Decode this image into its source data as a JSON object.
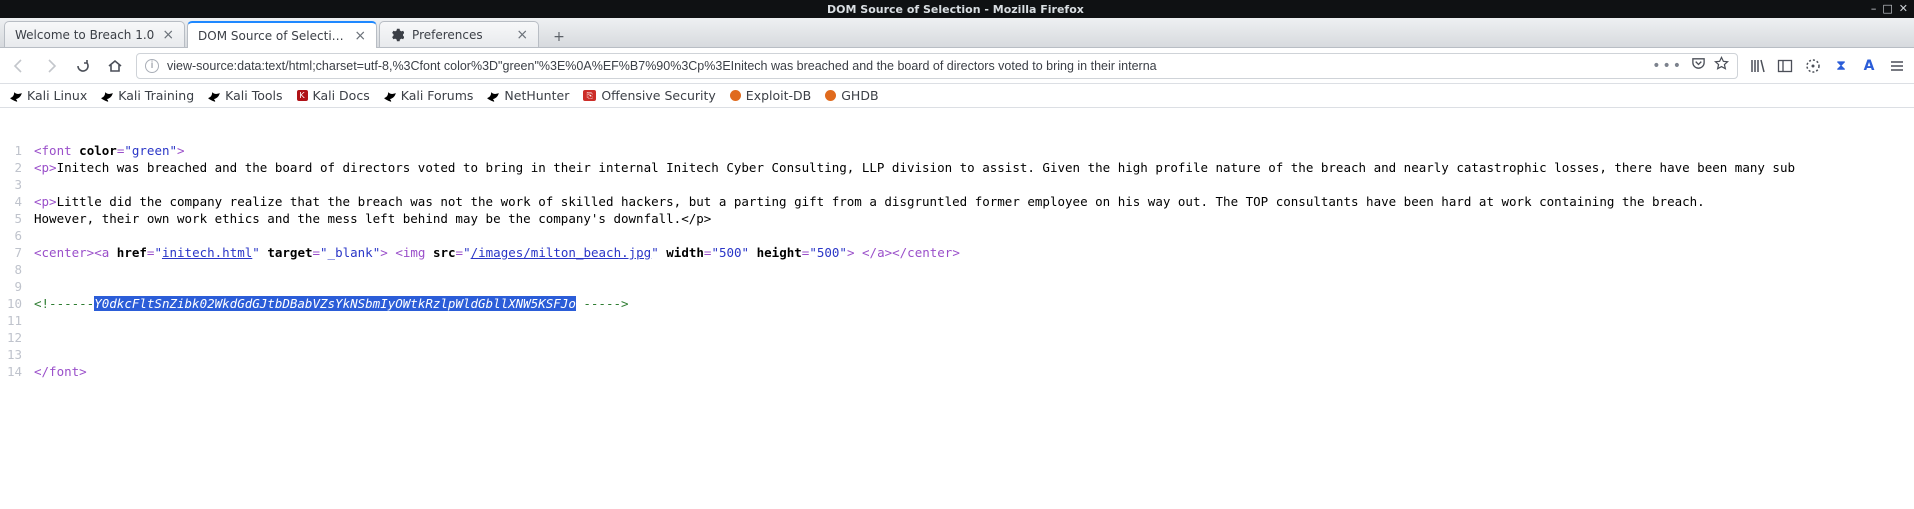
{
  "window": {
    "title": "DOM Source of Selection - Mozilla Firefox"
  },
  "tabs": [
    {
      "label": "Welcome to Breach 1.0",
      "kind": "page"
    },
    {
      "label": "DOM Source of Selection",
      "kind": "page",
      "active": true
    },
    {
      "label": "Preferences",
      "kind": "pref"
    }
  ],
  "nav": {
    "url": "view-source:data:text/html;charset=utf-8,%3Cfont color%3D\"green\"%3E%0A%EF%B7%90%3Cp%3EInitech was breached and the board of directors voted to bring in their interna"
  },
  "bookmarks": [
    {
      "label": "Kali Linux",
      "icon": "dragon"
    },
    {
      "label": "Kali Training",
      "icon": "dragon"
    },
    {
      "label": "Kali Tools",
      "icon": "dragon"
    },
    {
      "label": "Kali Docs",
      "icon": "red"
    },
    {
      "label": "Kali Forums",
      "icon": "dragon"
    },
    {
      "label": "NetHunter",
      "icon": "dragon"
    },
    {
      "label": "Offensive Security",
      "icon": "redbox"
    },
    {
      "label": "Exploit-DB",
      "icon": "orange"
    },
    {
      "label": "GHDB",
      "icon": "orange"
    }
  ],
  "source": {
    "lines": [
      {
        "n": 1,
        "type": "raw",
        "html": "<span class='c-tag'>&lt;</span><span class='c-tag'>font </span><span class='c-attname'>color</span><span class='c-tag'>=</span><span class='c-attval'>\"green\"</span><span class='c-tag'>&gt;</span>"
      },
      {
        "n": 2,
        "type": "raw",
        "html": "<span class='c-tag'>&lt;p&gt;</span><span class='c-text'>Initech was breached and the board of directors voted to bring in their internal Initech Cyber Consulting, LLP division to assist. Given the high profile nature of the breach and nearly catastrophic losses, there have been many sub</span>"
      },
      {
        "n": 3,
        "type": "raw",
        "html": ""
      },
      {
        "n": 4,
        "type": "raw",
        "html": "<span class='c-tag'>&lt;p&gt;</span><span class='c-text'>Little did the company realize that the breach was not the work of skilled hackers, but a parting gift from a disgruntled former employee on his way out. The TOP consultants have been hard at work containing the breach.</span>"
      },
      {
        "n": 5,
        "type": "raw",
        "html": "<span class='c-text'>However, their own work ethics and the mess left behind may be the company's downfall.&lt;/p&gt;</span>"
      },
      {
        "n": 6,
        "type": "raw",
        "html": ""
      },
      {
        "n": 7,
        "type": "raw",
        "html": "<span class='c-tag'>&lt;center&gt;&lt;a </span><span class='c-attname'>href</span><span class='c-tag'>=</span><span class='c-attval'>\"</span><span class='c-str'>initech.html</span><span class='c-attval'>\"</span> <span class='c-attname'>target</span><span class='c-tag'>=</span><span class='c-attval'>\"_blank\"</span><span class='c-tag'>&gt;</span> <span class='c-tag'>&lt;img </span><span class='c-attname'>src</span><span class='c-tag'>=</span><span class='c-attval'>\"</span><span class='c-str'>/images/milton_beach.jpg</span><span class='c-attval'>\"</span> <span class='c-attname'>width</span><span class='c-tag'>=</span><span class='c-attval'>\"500\"</span> <span class='c-attname'>height</span><span class='c-tag'>=</span><span class='c-attval'>\"500\"</span><span class='c-tag'>&gt;</span> <span class='c-tag'>&lt;/a&gt;&lt;/center&gt;</span>"
      },
      {
        "n": 8,
        "type": "raw",
        "html": ""
      },
      {
        "n": 9,
        "type": "raw",
        "html": ""
      },
      {
        "n": 10,
        "type": "raw",
        "html": "<span class='c-cmt'>&lt;!------</span><span class='c-sel'>Y0dkcFltSnZibk02WkdGdGJtbDBabVZsYkNSbmIyOWtkRzlpWldGbllXNW5KSFJo</span><span class='c-cmt'> -----&gt;</span>"
      },
      {
        "n": 11,
        "type": "raw",
        "html": ""
      },
      {
        "n": 12,
        "type": "raw",
        "html": ""
      },
      {
        "n": 13,
        "type": "raw",
        "html": ""
      },
      {
        "n": 14,
        "type": "raw",
        "html": "<span class='c-tag'>&lt;/font&gt;</span>"
      }
    ]
  }
}
